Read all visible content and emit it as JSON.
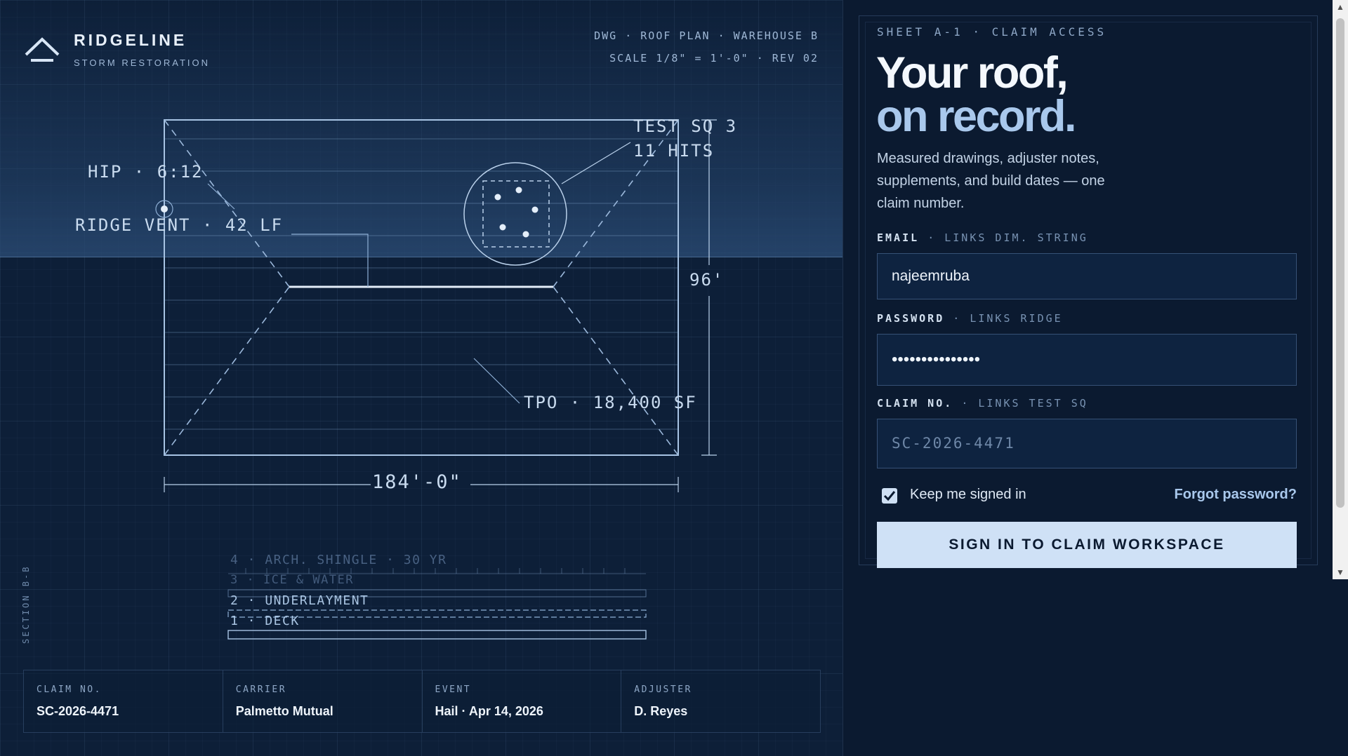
{
  "brand": {
    "name": "RIDGELINE",
    "sub": "STORM RESTORATION"
  },
  "drawing": {
    "line1": "DWG · ROOF PLAN · WAREHOUSE B",
    "line2": "SCALE 1/8\" = 1'-0\" · REV 02",
    "labels": {
      "test_sq_line1": "TEST SQ 3",
      "test_sq_line2": "11 HITS",
      "hip": "HIP · 6:12",
      "ridge_vent": "RIDGE VENT · 42 LF",
      "height": "96'",
      "tpo": "TPO · 18,400 SF",
      "width": "184'-0\""
    },
    "section_label": "SECTION B-B",
    "layers": [
      "4 · ARCH. SHINGLE · 30 YR",
      "3 · ICE & WATER",
      "2 · UNDERLAYMENT",
      "1 · DECK"
    ]
  },
  "info": [
    {
      "label": "CLAIM NO.",
      "value": "SC-2026-4471"
    },
    {
      "label": "CARRIER",
      "value": "Palmetto Mutual"
    },
    {
      "label": "EVENT",
      "value": "Hail · Apr 14, 2026"
    },
    {
      "label": "ADJUSTER",
      "value": "D. Reyes"
    }
  ],
  "panel": {
    "sheet": "SHEET A-1 · CLAIM ACCESS",
    "title_line1": "Your roof,",
    "title_line2": "on record.",
    "lede": "Measured drawings, adjuster notes, supplements, and build dates — one claim number.",
    "email_label": "EMAIL",
    "email_link": "· LINKS DIM. STRING",
    "email_value": "najeemruba",
    "password_label": "PASSWORD",
    "password_link": "· LINKS RIDGE",
    "password_value": "•••••••••••••••",
    "claim_label": "CLAIM NO.",
    "claim_link": "· LINKS TEST SQ",
    "claim_placeholder": "SC-2026-4471",
    "keep_label": "Keep me signed in",
    "keep_checked": true,
    "forgot": "Forgot password?",
    "signin": "SIGN IN TO CLAIM WORKSPACE"
  },
  "colors": {
    "background": "#0c1d33",
    "accent": "#a9c8ec",
    "button": "#cfe1f6"
  }
}
